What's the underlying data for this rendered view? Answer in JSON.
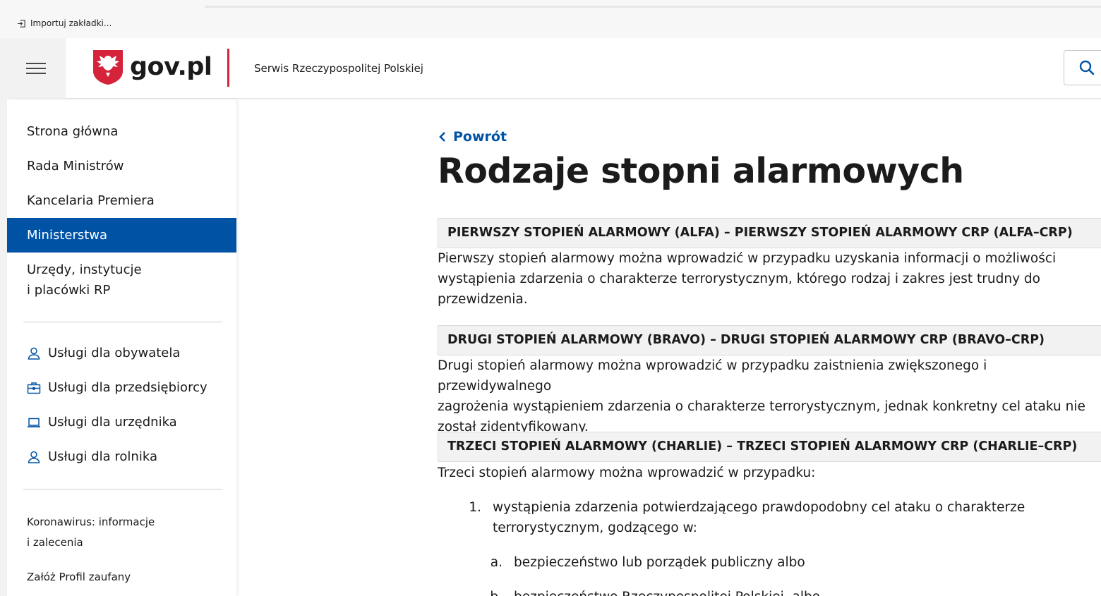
{
  "browser": {
    "import_bookmarks": "Importuj zakładki..."
  },
  "header": {
    "logo_text": "gov.pl",
    "tagline": "Serwis Rzeczypospolitej Polskiej",
    "accent_color": "#d5233b"
  },
  "sidebar": {
    "items": [
      {
        "label": "Strona główna"
      },
      {
        "label": "Rada Ministrów"
      },
      {
        "label": "Kancelaria Premiera"
      },
      {
        "label": "Ministerstwa",
        "active": true
      },
      {
        "label": "Urzędy, instytucje",
        "label2": "i placówki RP"
      }
    ],
    "services": [
      {
        "label": "Usługi dla obywatela",
        "icon": "person-icon"
      },
      {
        "label": "Usługi dla przedsiębiorcy",
        "icon": "briefcase-icon"
      },
      {
        "label": "Usługi dla urzędnika",
        "icon": "laptop-icon"
      },
      {
        "label": "Usługi dla rolnika",
        "icon": "person-icon"
      }
    ],
    "links": [
      {
        "label": "Koronawirus: informacje",
        "label2": "i zalecenia"
      },
      {
        "label": "Załóż Profil zaufany"
      }
    ],
    "active_color": "#0052a5"
  },
  "main": {
    "back_label": "Powrót",
    "title": "Rodzaje stopni alarmowych",
    "sections": [
      {
        "heading": "PIERWSZY STOPIEŃ ALARMOWY (ALFA) – PIERWSZY STOPIEŃ ALARMOWY CRP (ALFA–CRP)",
        "lines": [
          "Pierwszy stopień alarmowy można wprowadzić w przypadku uzyskania informacji o możliwości",
          "wystąpienia zdarzenia o charakterze terrorystycznym, którego rodzaj i zakres jest trudny do",
          "przewidzenia."
        ]
      },
      {
        "heading": "DRUGI STOPIEŃ ALARMOWY (BRAVO) – DRUGI STOPIEŃ ALARMOWY CRP (BRAVO–CRP)",
        "lines": [
          "Drugi stopień alarmowy można wprowadzić w przypadku zaistnienia zwiększonego i przewidywalnego",
          "zagrożenia wystąpieniem zdarzenia o charakterze terrorystycznym, jednak konkretny cel ataku nie",
          "został zidentyfikowany."
        ]
      },
      {
        "heading": "TRZECI STOPIEŃ ALARMOWY (CHARLIE) – TRZECI STOPIEŃ ALARMOWY CRP (CHARLIE–CRP)",
        "lines": [
          "Trzeci stopień alarmowy można wprowadzić w przypadku:"
        ]
      }
    ],
    "list": [
      {
        "num": "1.",
        "lines": [
          "wystąpienia zdarzenia potwierdzającego prawdopodobny cel ataku o charakterze",
          "terrorystycznym, godzącego w:"
        ]
      }
    ],
    "sublist": [
      {
        "num": "a.",
        "text": "bezpieczeństwo lub porządek publiczny albo"
      },
      {
        "num": "b.",
        "text": "bezpieczeństwo Rzeczypospolitej Polskiej, albo"
      }
    ],
    "link_color": "#0052a5"
  }
}
